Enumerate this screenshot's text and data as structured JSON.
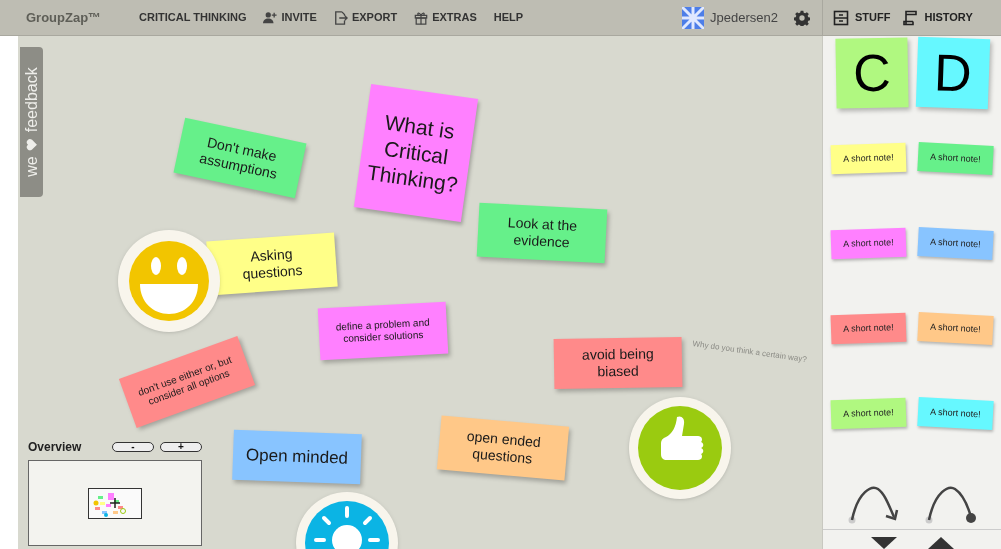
{
  "header": {
    "logo": "GroupZap™",
    "menu": [
      {
        "label": "CRITICAL THINKING",
        "kind": "plain"
      },
      {
        "label": "INVITE",
        "kind": "invite"
      },
      {
        "label": "EXPORT",
        "kind": "export"
      },
      {
        "label": "EXTRAS",
        "kind": "extras"
      },
      {
        "label": "HELP",
        "kind": "plain"
      }
    ],
    "user": "Jpedersen2",
    "panel_tabs": [
      {
        "label": "STUFF",
        "kind": "stuff"
      },
      {
        "label": "HISTORY",
        "kind": "history"
      }
    ]
  },
  "feedback_tab": {
    "before": "we",
    "after": "feedback"
  },
  "canvas": {
    "notes": [
      {
        "text": "Don't make assumptions",
        "color": "#66f08a"
      },
      {
        "text": "What is Critical Thinking?",
        "color": "#ff80ff"
      },
      {
        "text": "Look at the evidence",
        "color": "#66f08a"
      },
      {
        "text": "Asking questions",
        "color": "#ffff88"
      },
      {
        "text": "define a problem and consider solutions",
        "color": "#ff80ff"
      },
      {
        "text": "don't use either or, but consider all options",
        "color": "#ff8a8a"
      },
      {
        "text": "avoid being biased",
        "color": "#ff8a8a"
      },
      {
        "text": "Open minded",
        "color": "#88c4ff"
      },
      {
        "text": "open ended questions",
        "color": "#ffc888"
      }
    ],
    "comments": [
      "Why do you think a certain way?"
    ],
    "stickers": [
      {
        "kind": "smiley"
      },
      {
        "kind": "thumbs-up"
      },
      {
        "kind": "lightbulb"
      }
    ]
  },
  "overview": {
    "title": "Overview",
    "buttons": [
      "-",
      "+"
    ]
  },
  "stuff": {
    "letter_notes": [
      {
        "text": "C",
        "color": "#b0f880"
      },
      {
        "text": "D",
        "color": "#66f8ff"
      }
    ],
    "notes": [
      {
        "text": "A short note!",
        "color": "#ffff88"
      },
      {
        "text": "A short note!",
        "color": "#66f08a"
      },
      {
        "text": "A short note!",
        "color": "#ff80ff"
      },
      {
        "text": "A short note!",
        "color": "#88c4ff"
      },
      {
        "text": "A short note!",
        "color": "#ff8a8a"
      },
      {
        "text": "A short note!",
        "color": "#ffc888"
      },
      {
        "text": "A short note!",
        "color": "#b0f880"
      },
      {
        "text": "A short note!",
        "color": "#66f8ff"
      }
    ],
    "connectors": [
      {
        "kind": "arrow"
      },
      {
        "kind": "dot"
      }
    ]
  }
}
